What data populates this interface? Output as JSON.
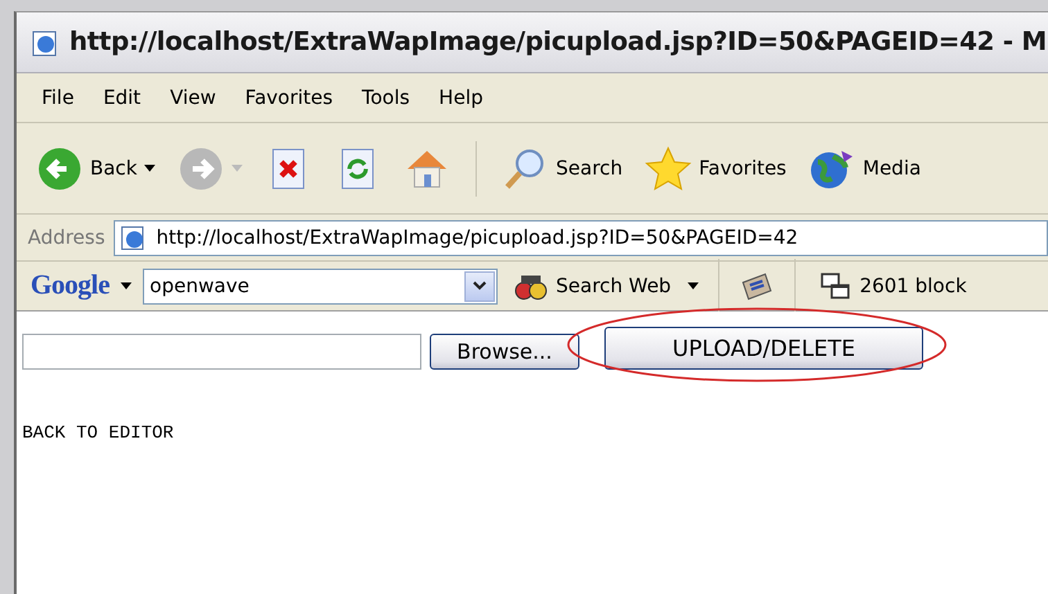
{
  "window": {
    "title": "http://localhost/ExtraWapImage/picupload.jsp?ID=50&PAGEID=42 - M"
  },
  "menu": [
    "File",
    "Edit",
    "View",
    "Favorites",
    "Tools",
    "Help"
  ],
  "toolbar": [
    {
      "kind": "back",
      "label": "Back",
      "disabled": false
    },
    {
      "kind": "forward",
      "disabled": true
    },
    {
      "kind": "stop"
    },
    {
      "kind": "refresh"
    },
    {
      "kind": "home"
    },
    {
      "kind": "search",
      "label": "Search"
    },
    {
      "kind": "favorites",
      "label": "Favorites"
    },
    {
      "kind": "media",
      "label": "Media"
    }
  ],
  "address": {
    "label": "Address",
    "value": "http://localhost/ExtraWapImage/picupload.jsp?ID=50&PAGEID=42"
  },
  "google_bar": {
    "logo": "Google",
    "query": "openwave",
    "search_button": "Search Web",
    "blocked": "2601 block"
  },
  "page": {
    "browse_button": "Browse...",
    "submit_button": "UPLOAD/DELETE",
    "link": "BACK TO EDITOR",
    "highlight_submit": true
  }
}
